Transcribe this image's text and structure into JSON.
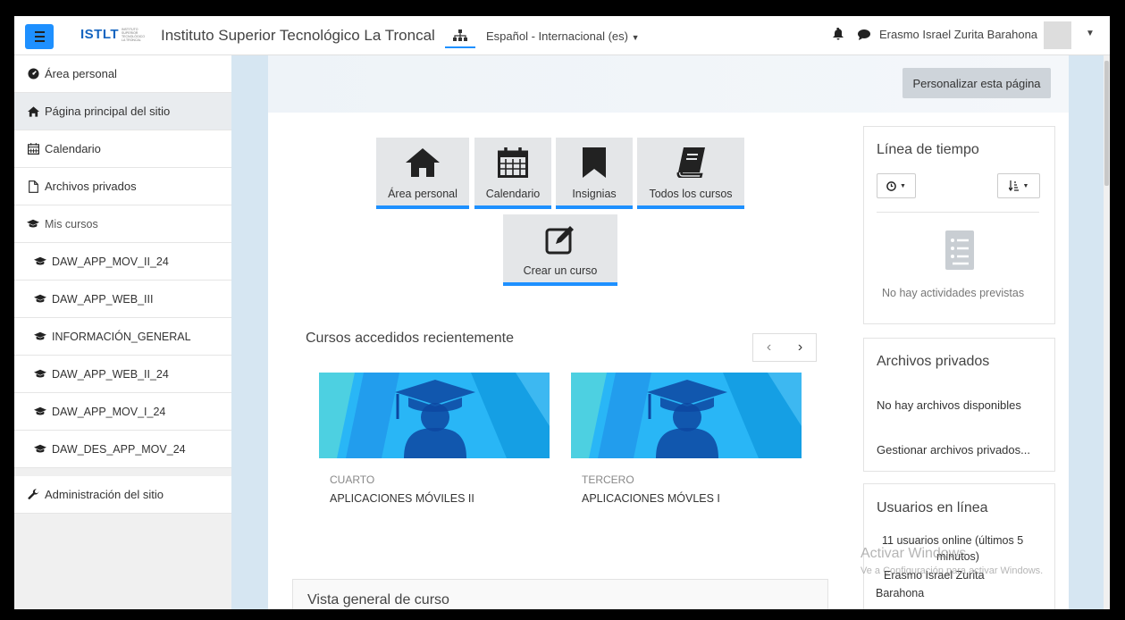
{
  "navbar": {
    "logo_text": "ISTLT",
    "logo_subtext": "INSTITUTO SUPERIOR TECNOLÓGICO LA TRONCAL",
    "site_name": "Instituto Superior Tecnológico La Troncal",
    "language": "Español - Internacional (es)",
    "user_name": "Erasmo Israel Zurita Barahona"
  },
  "sidebar": {
    "items": [
      {
        "label": "Área personal",
        "icon": "dashboard-icon"
      },
      {
        "label": "Página principal del sitio",
        "icon": "home-icon"
      },
      {
        "label": "Calendario",
        "icon": "calendar-icon"
      },
      {
        "label": "Archivos privados",
        "icon": "file-icon"
      }
    ],
    "mis_cursos": "Mis cursos",
    "courses": [
      "DAW_APP_MOV_II_24",
      "DAW_APP_WEB_III",
      "INFORMACIÓN_GENERAL",
      "DAW_APP_WEB_II_24",
      "DAW_APP_MOV_I_24",
      "DAW_DES_APP_MOV_24"
    ],
    "admin": "Administración del sitio"
  },
  "header": {
    "customize_button": "Personalizar esta página"
  },
  "tiles": [
    {
      "label": "Área personal",
      "icon": "home-icon"
    },
    {
      "label": "Calendario",
      "icon": "calendar-icon"
    },
    {
      "label": "Insignias",
      "icon": "bookmark-icon"
    },
    {
      "label": "Todos los cursos",
      "icon": "book-icon"
    },
    {
      "label": "Crear un curso",
      "icon": "edit-icon"
    }
  ],
  "recent": {
    "title": "Cursos accedidos recientemente",
    "prev": "‹",
    "next": "›",
    "courses": [
      {
        "category": "CUARTO",
        "name": "APLICACIONES MÓVILES II"
      },
      {
        "category": "TERCERO",
        "name": "APLICACIONES MÓVLES I"
      }
    ]
  },
  "overview": {
    "title": "Vista general de curso"
  },
  "timeline": {
    "title": "Línea de tiempo",
    "empty": "No hay actividades previstas"
  },
  "private_files": {
    "title": "Archivos privados",
    "empty": "No hay archivos disponibles",
    "manage": "Gestionar archivos privados..."
  },
  "online_users": {
    "title": "Usuarios en línea",
    "summary_line1": "11 usuarios online (últimos 5",
    "summary_line2": "minutos)",
    "user_line1": "Erasmo Israel Zurita",
    "user_line2": "Barahona"
  },
  "watermark": {
    "line1": "Activar Windows",
    "line2": "Ve a Configuración para activar Windows."
  },
  "colors": {
    "accent": "#1e90ff",
    "card_banner": "#29b6f6"
  }
}
